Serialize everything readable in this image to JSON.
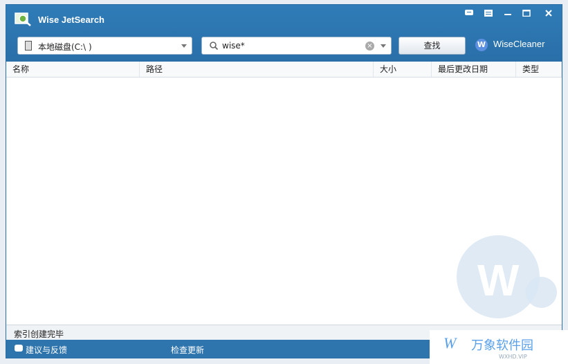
{
  "app": {
    "title": "Wise JetSearch"
  },
  "window_controls": [
    "feedback-icon",
    "menu-icon",
    "minimize-icon",
    "maximize-icon",
    "close-icon"
  ],
  "drive_select": {
    "value": "本地磁盘(C:\\ )"
  },
  "search": {
    "value": "wise*"
  },
  "find_button": {
    "label": "查找"
  },
  "brand": {
    "logo": "W",
    "name": "WiseCleaner"
  },
  "columns": [
    "名称",
    "路径",
    "大小",
    "最后更改日期",
    "类型"
  ],
  "status": {
    "text": "索引创建完毕"
  },
  "footer": {
    "feedback": "建议与反馈",
    "check_update": "检查更新"
  },
  "watermark": {
    "letter": "W"
  },
  "site_watermark": {
    "logo": "W",
    "name": "万象软件园",
    "sub": "WXHD.VIP"
  },
  "colors": {
    "header": "#2f7cb8",
    "footer": "#2f75ad",
    "accent": "#5aa0e8"
  }
}
